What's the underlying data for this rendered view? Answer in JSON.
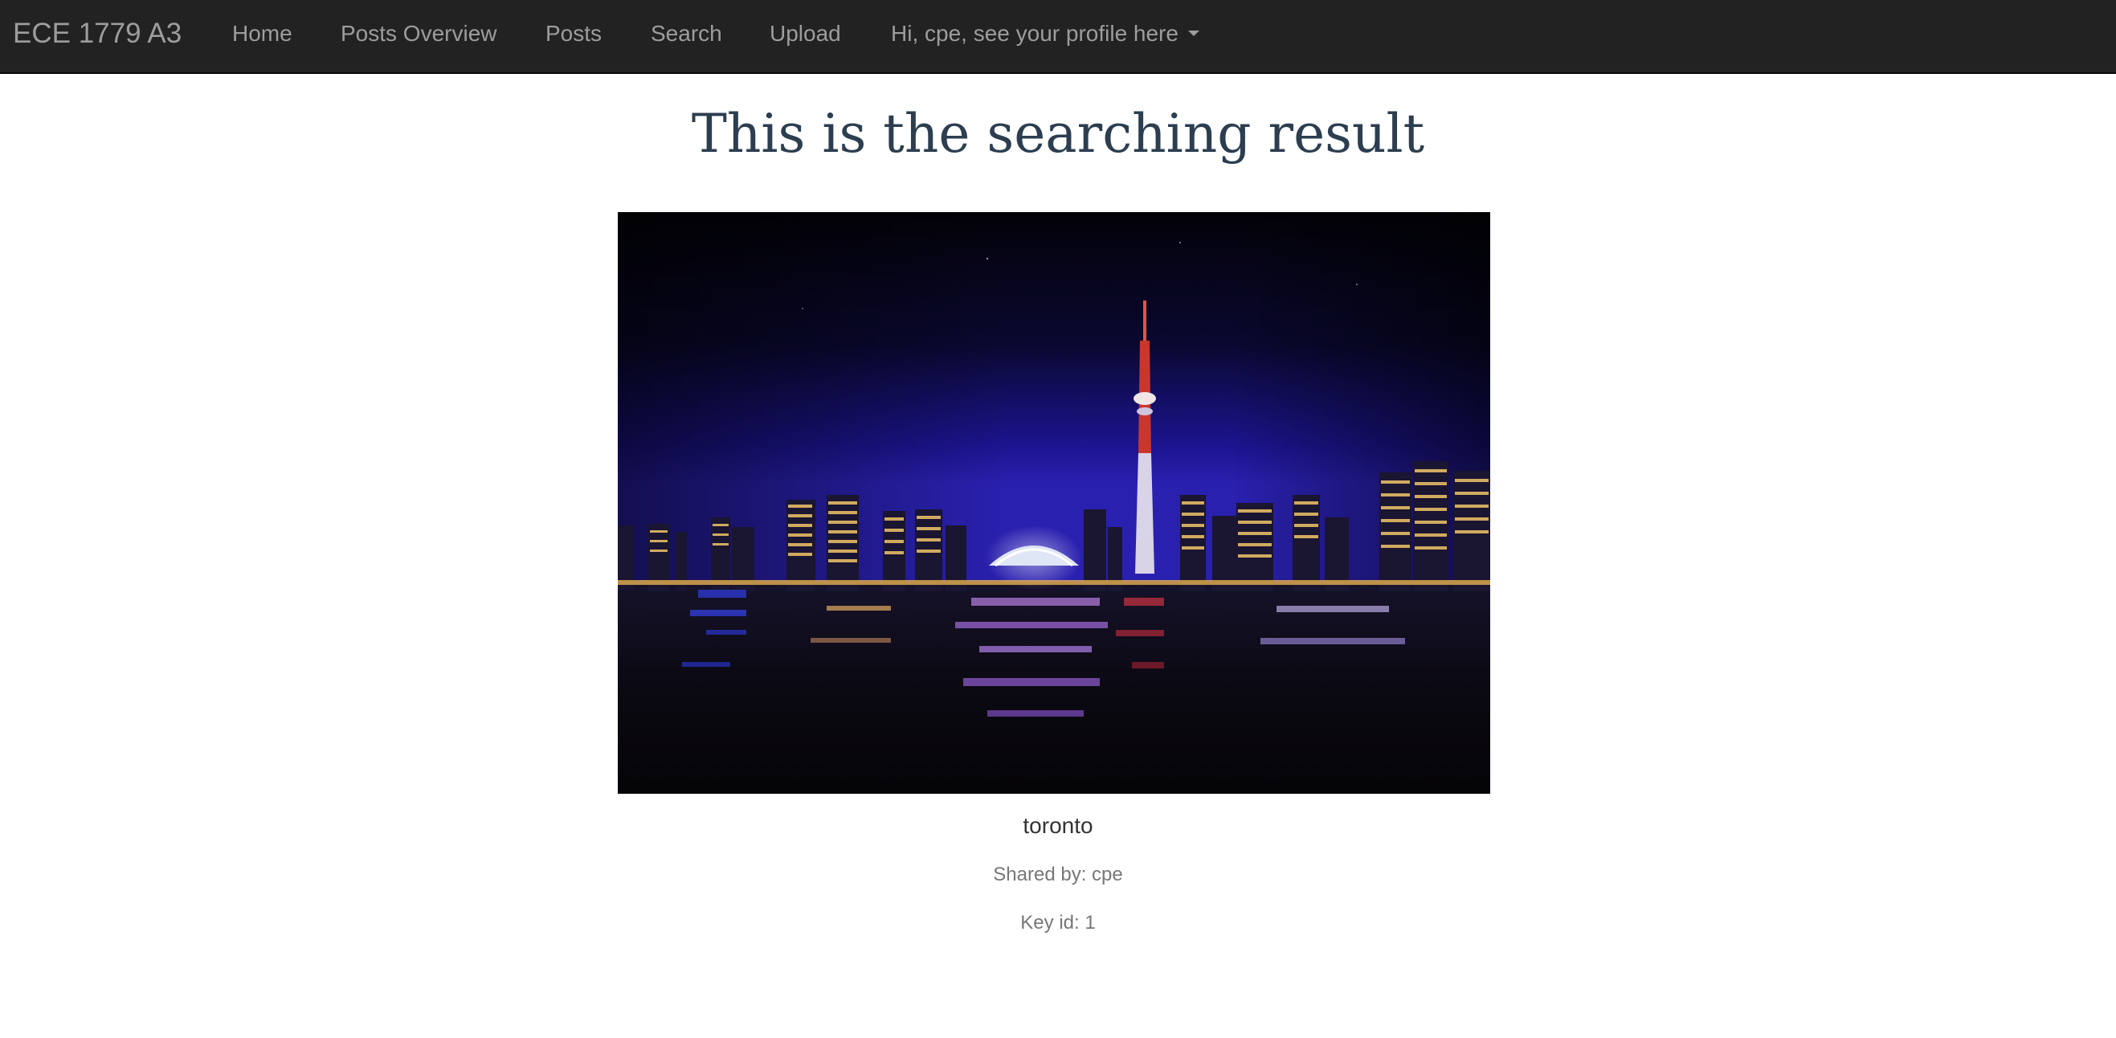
{
  "navbar": {
    "brand": "ECE 1779 A3",
    "items": [
      {
        "label": "Home"
      },
      {
        "label": "Posts Overview"
      },
      {
        "label": "Posts"
      },
      {
        "label": "Search"
      },
      {
        "label": "Upload"
      }
    ],
    "profile_dropdown": {
      "label": "Hi, cpe, see your profile here",
      "icon": "caret-down-icon"
    }
  },
  "main": {
    "title": "This is the searching result",
    "result": {
      "image_icon": "toronto-night-skyline-photo",
      "name": "toronto",
      "shared_by": "Shared by: cpe",
      "key_id": "Key id: 1"
    }
  },
  "colors": {
    "navbar_bg": "#222222",
    "navbar_text": "#9d9d9d",
    "title_text": "#2c3e50",
    "muted_text": "#777777"
  }
}
